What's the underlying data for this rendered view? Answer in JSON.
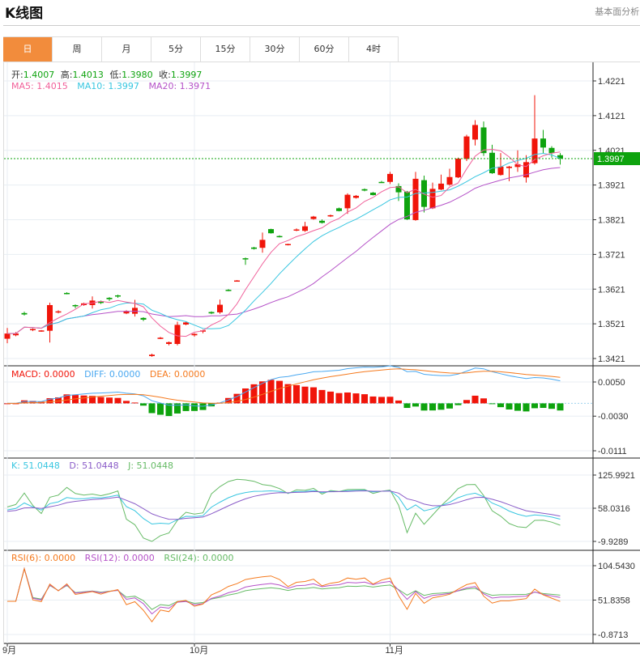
{
  "header": {
    "title": "K线图",
    "more_link": "基本面分析»"
  },
  "tabs": [
    {
      "label": "日",
      "active": true
    },
    {
      "label": "周"
    },
    {
      "label": "月"
    },
    {
      "label": "5分"
    },
    {
      "label": "15分"
    },
    {
      "label": "30分"
    },
    {
      "label": "60分"
    },
    {
      "label": "4时"
    }
  ],
  "ohlc_legend": {
    "open_label": "开:",
    "open": "1.4007",
    "high_label": "高:",
    "high": "1.4013",
    "low_label": "低:",
    "low": "1.3980",
    "close_label": "收:",
    "close": "1.3997"
  },
  "ma_legend": {
    "ma5": "MA5: 1.4015",
    "ma10": "MA10: 1.3997",
    "ma20": "MA20: 1.3971"
  },
  "macd_legend": {
    "macd": "MACD: 0.0000",
    "diff": "DIFF: 0.0000",
    "dea": "DEA: 0.0000"
  },
  "kdj_legend": {
    "k": "K: 51.0448",
    "d": "D: 51.0448",
    "j": "J: 51.0448"
  },
  "rsi_legend": {
    "rsi6": "RSI(6): 0.0000",
    "rsi12": "RSI(12): 0.0000",
    "rsi24": "RSI(24): 0.0000"
  },
  "last_price": "1.3997",
  "colors": {
    "up": "#f0150a",
    "down": "#0ea30e",
    "ma5": "#f0609a",
    "ma10": "#38c6e0",
    "ma20": "#b552c8",
    "diff": "#4aa8f0",
    "dea": "#f57a1e",
    "k": "#38c6e0",
    "d": "#8a5cc8",
    "j": "#66bb66",
    "rsi6": "#f57a1e",
    "rsi12": "#b552c8",
    "rsi24": "#66bb66",
    "tab_active": "#f28c3c"
  },
  "chart_data": {
    "type": "candlestick",
    "x_labels": [
      {
        "index": 0,
        "label": "9月"
      },
      {
        "index": 22,
        "label": "10月"
      },
      {
        "index": 45,
        "label": "11月"
      }
    ],
    "price_axis": {
      "ticks": [
        "1.4221",
        "1.4121",
        "1.4021",
        "1.3921",
        "1.3821",
        "1.3721",
        "1.3621",
        "1.3521",
        "1.3421"
      ],
      "range": [
        1.3421,
        1.4221
      ]
    },
    "macd_axis": {
      "ticks": [
        "0.0050",
        "-0.0030",
        "-0.0111"
      ],
      "range": [
        -0.0111,
        0.005
      ]
    },
    "kdj_axis": {
      "ticks": [
        "125.9921",
        "58.0316",
        "-9.9289"
      ],
      "range": [
        -9.9289,
        125.9921
      ]
    },
    "rsi_axis": {
      "ticks": [
        "104.5430",
        "51.8358",
        "-0.8713"
      ],
      "range": [
        -0.8713,
        104.543
      ]
    },
    "ohlc": [
      [
        1.3478,
        1.3509,
        1.3465,
        1.3493
      ],
      [
        1.3488,
        1.3497,
        1.3485,
        1.3493
      ],
      [
        1.3552,
        1.3556,
        1.3545,
        1.3548
      ],
      [
        1.3503,
        1.3508,
        1.35,
        1.3506
      ],
      [
        1.35,
        1.3503,
        1.3498,
        1.3502
      ],
      [
        1.3501,
        1.3582,
        1.3467,
        1.3575
      ],
      [
        1.3554,
        1.356,
        1.3551,
        1.3557
      ],
      [
        1.361,
        1.3612,
        1.3606,
        1.3608
      ],
      [
        1.3575,
        1.3577,
        1.3566,
        1.3572
      ],
      [
        1.3575,
        1.3582,
        1.3573,
        1.358
      ],
      [
        1.3575,
        1.36,
        1.3565,
        1.3588
      ],
      [
        1.3586,
        1.3588,
        1.3578,
        1.3581
      ],
      [
        1.3596,
        1.3598,
        1.3587,
        1.3592
      ],
      [
        1.3603,
        1.3605,
        1.3596,
        1.36
      ],
      [
        1.3551,
        1.356,
        1.3549,
        1.3558
      ],
      [
        1.355,
        1.359,
        1.3542,
        1.3567
      ],
      [
        1.3538,
        1.354,
        1.3529,
        1.3533
      ],
      [
        1.3428,
        1.3435,
        1.3426,
        1.3432
      ],
      [
        1.3479,
        1.3483,
        1.3477,
        1.3481
      ],
      [
        1.3463,
        1.347,
        1.3459,
        1.3468
      ],
      [
        1.3463,
        1.3527,
        1.3459,
        1.3518
      ],
      [
        1.3519,
        1.3527,
        1.3517,
        1.3525
      ],
      [
        1.3488,
        1.3494,
        1.3484,
        1.3492
      ],
      [
        1.3499,
        1.3504,
        1.3494,
        1.3502
      ],
      [
        1.3555,
        1.3557,
        1.3549,
        1.3551
      ],
      [
        1.3554,
        1.3591,
        1.355,
        1.3576
      ],
      [
        1.3619,
        1.3621,
        1.3615,
        1.3617
      ],
      [
        1.3644,
        1.3647,
        1.3643,
        1.3646
      ],
      [
        1.371,
        1.3712,
        1.3691,
        1.3707
      ],
      [
        1.3741,
        1.3743,
        1.3735,
        1.3737
      ],
      [
        1.374,
        1.3784,
        1.3726,
        1.3763
      ],
      [
        1.3794,
        1.3795,
        1.3781,
        1.3782
      ],
      [
        1.3774,
        1.3776,
        1.377,
        1.3772
      ],
      [
        1.3749,
        1.3752,
        1.3747,
        1.3751
      ],
      [
        1.3791,
        1.3796,
        1.3788,
        1.3793
      ],
      [
        1.3789,
        1.3815,
        1.3786,
        1.3802
      ],
      [
        1.3823,
        1.3832,
        1.3821,
        1.383
      ],
      [
        1.3818,
        1.3822,
        1.381,
        1.3812
      ],
      [
        1.3831,
        1.3836,
        1.3829,
        1.3834
      ],
      [
        1.3854,
        1.3856,
        1.3845,
        1.3846
      ],
      [
        1.3854,
        1.3897,
        1.3838,
        1.3893
      ],
      [
        1.3884,
        1.3892,
        1.3882,
        1.389
      ],
      [
        1.3909,
        1.3911,
        1.3903,
        1.3905
      ],
      [
        1.3899,
        1.3901,
        1.3891,
        1.3892
      ],
      [
        1.393,
        1.3933,
        1.3927,
        1.3928
      ],
      [
        1.393,
        1.3959,
        1.3924,
        1.3953
      ],
      [
        1.3918,
        1.3926,
        1.3875,
        1.39
      ],
      [
        1.3902,
        1.3904,
        1.382,
        1.3822
      ],
      [
        1.382,
        1.3959,
        1.3818,
        1.3939
      ],
      [
        1.3935,
        1.3948,
        1.3842,
        1.3858
      ],
      [
        1.3854,
        1.3928,
        1.3852,
        1.391
      ],
      [
        1.3908,
        1.3951,
        1.3906,
        1.3925
      ],
      [
        1.3922,
        1.3968,
        1.3919,
        1.3944
      ],
      [
        1.3943,
        1.4,
        1.3941,
        1.3997
      ],
      [
        1.3996,
        1.4066,
        1.399,
        1.4061
      ],
      [
        1.4052,
        1.4108,
        1.4035,
        1.4094
      ],
      [
        1.4087,
        1.4104,
        1.4005,
        1.4013
      ],
      [
        1.4014,
        1.4037,
        1.3953,
        1.3955
      ],
      [
        1.395,
        1.4013,
        1.3948,
        1.3974
      ],
      [
        1.397,
        1.3976,
        1.3932,
        1.3974
      ],
      [
        1.3973,
        1.4021,
        1.3959,
        1.3981
      ],
      [
        1.3943,
        1.4007,
        1.3928,
        1.3987
      ],
      [
        1.3984,
        1.418,
        1.398,
        1.4055
      ],
      [
        1.4055,
        1.408,
        1.4012,
        1.4029
      ],
      [
        1.4028,
        1.4033,
        1.4,
        1.4013
      ],
      [
        1.4007,
        1.4013,
        1.398,
        1.3997
      ]
    ]
  }
}
